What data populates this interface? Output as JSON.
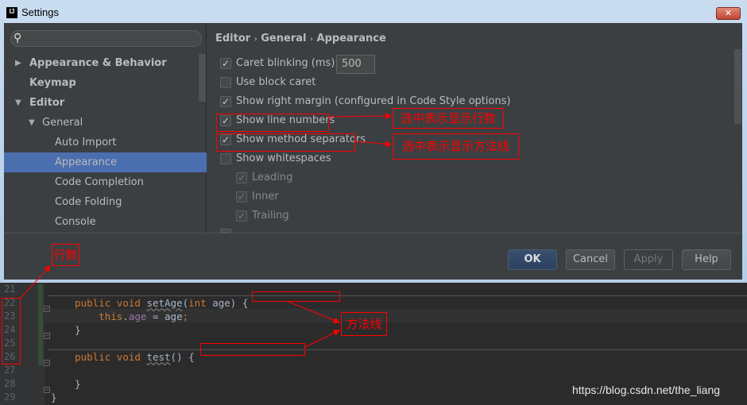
{
  "window": {
    "title": "Settings",
    "app_icon": "IJ",
    "close_icon": "close-icon"
  },
  "sidebar": {
    "search_placeholder": "",
    "items": [
      {
        "label": "Appearance & Behavior",
        "expanded": false
      },
      {
        "label": "Keymap"
      },
      {
        "label": "Editor",
        "expanded": true
      },
      {
        "label": "General",
        "expanded": true
      },
      {
        "label": "Auto Import"
      },
      {
        "label": "Appearance",
        "selected": true
      },
      {
        "label": "Code Completion"
      },
      {
        "label": "Code Folding"
      },
      {
        "label": "Console"
      }
    ]
  },
  "breadcrumb": [
    "Editor",
    "General",
    "Appearance"
  ],
  "breadcrumb_sep": "›",
  "options": [
    {
      "label": "Caret blinking (ms):",
      "checked": true,
      "value": "500"
    },
    {
      "label": "Use block caret",
      "checked": false
    },
    {
      "label": "Show right margin (configured in Code Style options)",
      "checked": true
    },
    {
      "label": "Show line numbers",
      "checked": true
    },
    {
      "label": "Show method separators",
      "checked": true
    },
    {
      "label": "Show whitespaces",
      "checked": false
    },
    {
      "label": "Leading",
      "checked": true,
      "disabled": true
    },
    {
      "label": "Inner",
      "checked": true,
      "disabled": true
    },
    {
      "label": "Trailing",
      "checked": true,
      "disabled": true
    }
  ],
  "buttons": {
    "ok": "OK",
    "cancel": "Cancel",
    "apply": "Apply",
    "help": "Help"
  },
  "editor": {
    "line_numbers": [
      "21",
      "22",
      "23",
      "24",
      "25",
      "26",
      "27",
      "28",
      "29"
    ],
    "lines": [
      {
        "tokens": []
      },
      {
        "tokens": [
          {
            "t": "    "
          },
          {
            "t": "public",
            "c": "kw"
          },
          {
            "t": " "
          },
          {
            "t": "void",
            "c": "kw"
          },
          {
            "t": " "
          },
          {
            "t": "setAge",
            "c": "fn"
          },
          {
            "t": "("
          },
          {
            "t": "int",
            "c": "kw"
          },
          {
            "t": " age) {"
          }
        ]
      },
      {
        "tokens": [
          {
            "t": "        "
          },
          {
            "t": "this",
            "c": "kw"
          },
          {
            "t": "."
          },
          {
            "t": "age",
            "c": "fld"
          },
          {
            "t": " = age"
          },
          {
            "t": ";",
            "c": "kw"
          }
        ]
      },
      {
        "tokens": [
          {
            "t": "    }"
          }
        ]
      },
      {
        "tokens": []
      },
      {
        "tokens": [
          {
            "t": "    "
          },
          {
            "t": "public",
            "c": "kw"
          },
          {
            "t": " "
          },
          {
            "t": "void",
            "c": "kw"
          },
          {
            "t": " "
          },
          {
            "t": "test",
            "c": "fn"
          },
          {
            "t": "() {"
          }
        ]
      },
      {
        "tokens": []
      },
      {
        "tokens": [
          {
            "t": "    }"
          }
        ]
      },
      {
        "tokens": [
          {
            "t": "}"
          }
        ]
      }
    ]
  },
  "annotations": {
    "line_numbers_label": "选中表示显示行数",
    "method_separators_label": "选中表示显示方法线",
    "line_count": "行数",
    "method_line": "方法线",
    "color": "#ff0000"
  },
  "watermark": "https://blog.csdn.net/the_liang",
  "colors": {
    "panel": "#3c3f41",
    "selection": "#4b6eaf",
    "editor_bg": "#2b2b2b",
    "keyword": "#cc7832"
  }
}
